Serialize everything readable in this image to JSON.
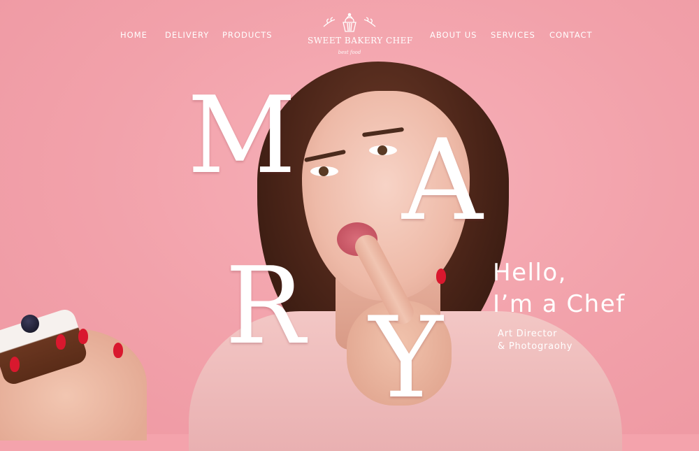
{
  "nav": {
    "left_links": [
      "HOME",
      "DELIVERY",
      "PRODUCTS"
    ],
    "right_links": [
      "ABOUT US",
      "SERVICES",
      "CONTACT"
    ]
  },
  "logo": {
    "icon": "cupcake-icon",
    "text": "SWEET BAKERY CHEF",
    "sub": "best food"
  },
  "hero": {
    "letters": [
      "M",
      "A",
      "R",
      "Y"
    ],
    "greeting_line1": "Hello,",
    "greeting_line2": "I’m a Chef",
    "role_line1": "Art Director",
    "role_line2": "& Photograohy"
  },
  "colors": {
    "background": "#f4a3ac",
    "text": "#ffffff",
    "nail_polish": "#d9182e"
  }
}
